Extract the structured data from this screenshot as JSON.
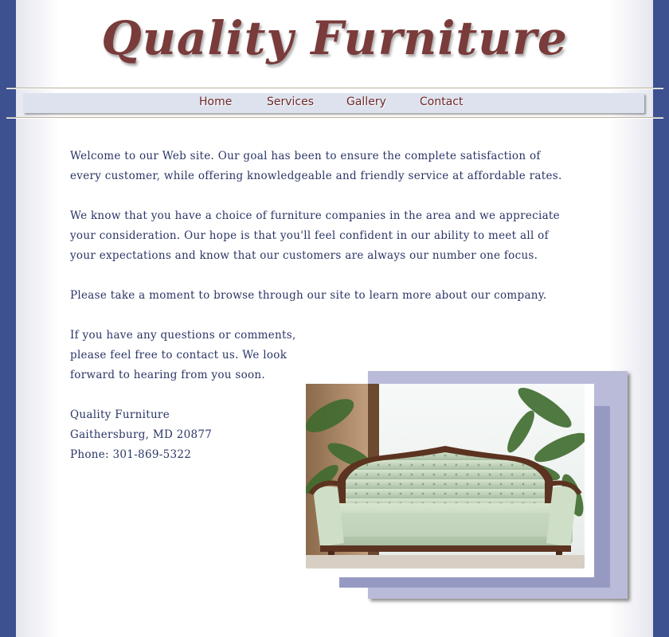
{
  "site": {
    "logo_text": "Quality Furniture"
  },
  "nav": {
    "items": [
      {
        "label": "Home"
      },
      {
        "label": "Services"
      },
      {
        "label": "Gallery"
      },
      {
        "label": "Contact"
      }
    ]
  },
  "content": {
    "paragraphs": [
      "Welcome to our Web site. Our goal has been to ensure the complete satisfaction of every customer, while offering knowledgeable and friendly service at affordable rates.",
      "We know that you have a choice of furniture companies in the area and we appreciate your consideration. Our hope is that you'll feel confident in our ability to meet all of your expectations and know that our customers are always our number one focus.",
      "Please take a moment to browse through our site to learn more about our company.",
      "If you have any questions or comments, please feel free to contact us. We look forward to hearing from you soon."
    ],
    "address": {
      "name": "Quality Furniture",
      "city": "Gaithersburg, MD 20877",
      "phone": "Phone: 301-869-5322"
    }
  },
  "colors": {
    "background": "#3d5090",
    "nav_text": "#6e2727",
    "body_text": "#2a3566",
    "logo": "#7a3b3b"
  }
}
